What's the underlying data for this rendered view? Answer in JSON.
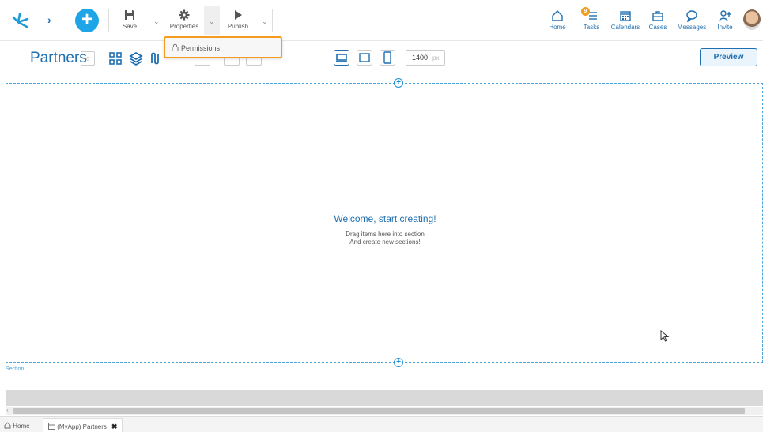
{
  "toolbar": {
    "save_label": "Save",
    "properties_label": "Properties",
    "publish_label": "Publish"
  },
  "properties_menu": {
    "items": [
      {
        "label": "Permissions",
        "icon": "lock-icon"
      }
    ]
  },
  "nav": {
    "home": "Home",
    "tasks": "Tasks",
    "tasks_badge": "9",
    "calendars": "Calendars",
    "cases": "Cases",
    "messages": "Messages",
    "invite": "Invite"
  },
  "page": {
    "title": "Partners",
    "width_value": "1400",
    "width_unit": "px",
    "preview_label": "Preview"
  },
  "canvas": {
    "welcome_title": "Welcome, start creating!",
    "welcome_line1": "Drag items here into section",
    "welcome_line2": "And create new sections!",
    "section_label": "Section"
  },
  "statusbar": {
    "home_label": "Home",
    "tab_label": "(MyApp) Partners",
    "close_glyph": "✖"
  },
  "colors": {
    "accent": "#1f6fb0",
    "add_button": "#1ea5e8",
    "highlight_border": "#f39c1e",
    "section_border": "#4aa6dc"
  }
}
